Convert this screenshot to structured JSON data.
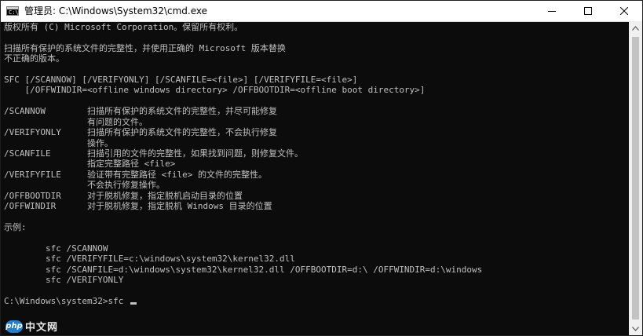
{
  "window": {
    "title": "管理员: C:\\Windows\\System32\\cmd.exe"
  },
  "console": {
    "lines": [
      "版权所有 (C) Microsoft Corporation。保留所有权利。",
      "",
      "扫描所有保护的系统文件的完整性，并使用正确的 Microsoft 版本替换",
      "不正确的版本。",
      "",
      "SFC [/SCANNOW] [/VERIFYONLY] [/SCANFILE=<file>] [/VERIFYFILE=<file>]",
      "    [/OFFWINDIR=<offline windows directory> /OFFBOOTDIR=<offline boot directory>]",
      "",
      "/SCANNOW        扫描所有保护的系统文件的完整性，并尽可能修复",
      "                有问题的文件。",
      "/VERIFYONLY     扫描所有保护的系统文件的完整性，不会执行修复",
      "                操作。",
      "/SCANFILE       扫描引用的文件的完整性，如果找到问题，则修复文件。",
      "                指定完整路径 <file>",
      "/VERIFYFILE     验证带有完整路径 <file> 的文件的完整性。",
      "                不会执行修复操作。",
      "/OFFBOOTDIR     对于脱机修复，指定脱机启动目录的位置",
      "/OFFWINDIR      对于脱机修复，指定脱机 Windows 目录的位置",
      "",
      "示例:",
      "",
      "        sfc /SCANNOW",
      "        sfc /VERIFYFILE=c:\\windows\\system32\\kernel32.dll",
      "        sfc /SCANFILE=d:\\windows\\system32\\kernel32.dll /OFFBOOTDIR=d:\\ /OFFWINDIR=d:\\windows",
      "        sfc /VERIFYONLY",
      ""
    ],
    "prompt": "C:\\Windows\\system32>sfc "
  },
  "watermark": {
    "logo": "php",
    "text": "中文网"
  },
  "icons": {
    "app": "cmd-app-icon",
    "minimize": "minimize-icon",
    "maximize": "maximize-icon",
    "close": "close-icon",
    "scroll_up": "scroll-up-arrow-icon",
    "scroll_down": "scroll-down-arrow-icon"
  },
  "colors": {
    "console_bg": "#0c0c0c",
    "console_fg": "#c0c0c0",
    "titlebar_bg": "#ffffff",
    "watermark_accent": "#1e7fd1"
  }
}
